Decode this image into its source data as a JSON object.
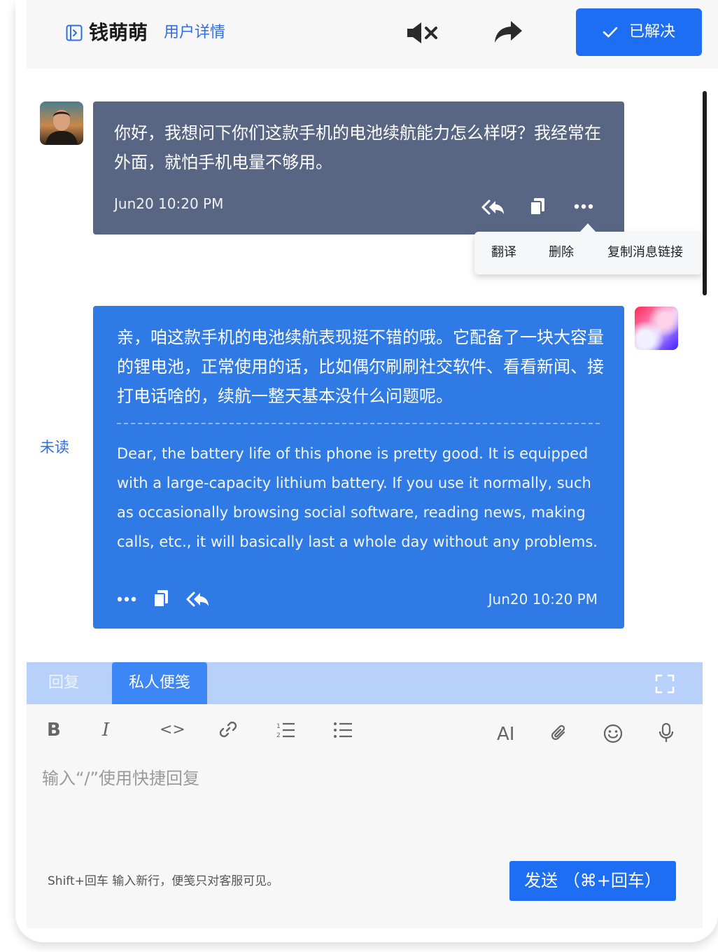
{
  "header": {
    "user_name": "钱萌萌",
    "user_detail_link": "用户详情",
    "resolve_label": "已解决"
  },
  "conversation": {
    "incoming": {
      "text": "你好，我想问下你们这款手机的电池续航能力怎么样呀？我经常在外面，就怕手机电量不够用。",
      "time": "Jun20 10:20 PM"
    },
    "context_menu": {
      "items": [
        "翻译",
        "删除",
        "复制消息链接"
      ]
    },
    "outgoing": {
      "unread_label": "未读",
      "text": "亲，咱这款手机的电池续航表现挺不错的哦。它配备了一块大容量的锂电池，正常使用的话，比如偶尔刷刷社交软件、看看新闻、接打电话啥的，续航一整天基本没什么问题呢。",
      "translation": "Dear, the battery life of this phone is pretty good. It is equipped with a large-capacity lithium battery. If you use it normally, such as occasionally browsing social software, reading news, making calls, etc., it will basically last a whole day without any problems.",
      "time": "Jun20 10:20 PM"
    }
  },
  "composer": {
    "tabs": [
      "回复",
      "私人便笺"
    ],
    "active_tab": "私人便笺",
    "toolbar": {
      "bold": "B",
      "italic": "I",
      "code": "<>",
      "ai": "AI"
    },
    "placeholder": "输入“/”使用快捷回复",
    "hint": "Shift+回车 输入新行，便笺只对客服可见。",
    "send_label": "发送 （⌘+回车）"
  },
  "colors": {
    "accent": "#1e6ef3",
    "incoming_bubble": "#596683",
    "outgoing_bubble": "#2f7ae5",
    "tab_bar": "#b8d1fb",
    "active_tab": "#3d86f5"
  }
}
